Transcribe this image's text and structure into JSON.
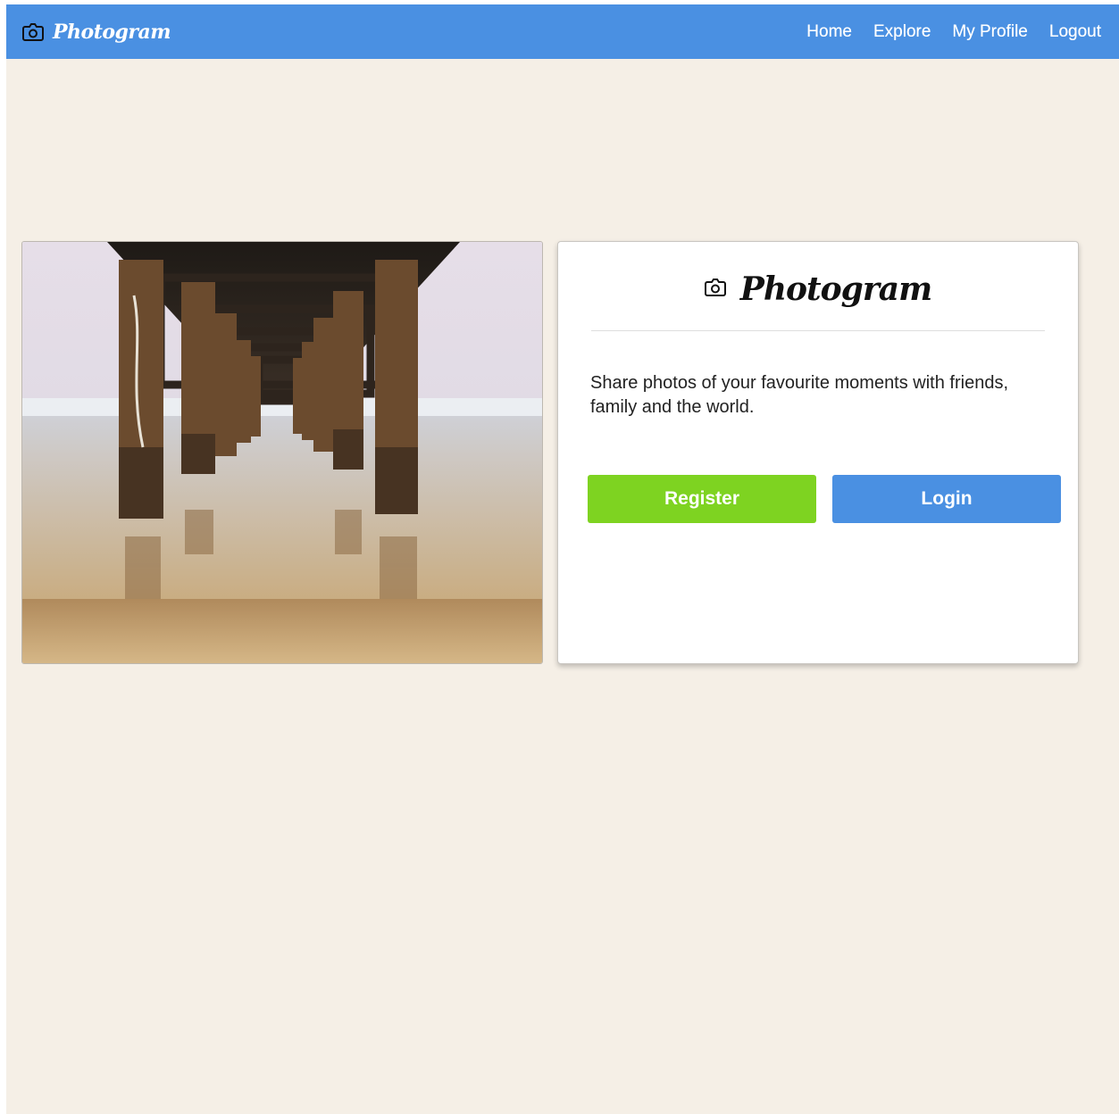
{
  "navbar": {
    "brand": "Photogram",
    "links": [
      "Home",
      "Explore",
      "My Profile",
      "Logout"
    ]
  },
  "hero": {
    "logo_text": "Photogram",
    "tagline": "Share photos of your favourite moments with friends, family and the world.",
    "register_label": "Register",
    "login_label": "Login"
  },
  "colors": {
    "navbar": "#4a90e2",
    "page_background": "#f5efe6",
    "register_button": "#7ed321",
    "login_button": "#4a90e2"
  },
  "icons": [
    "camera-icon"
  ]
}
